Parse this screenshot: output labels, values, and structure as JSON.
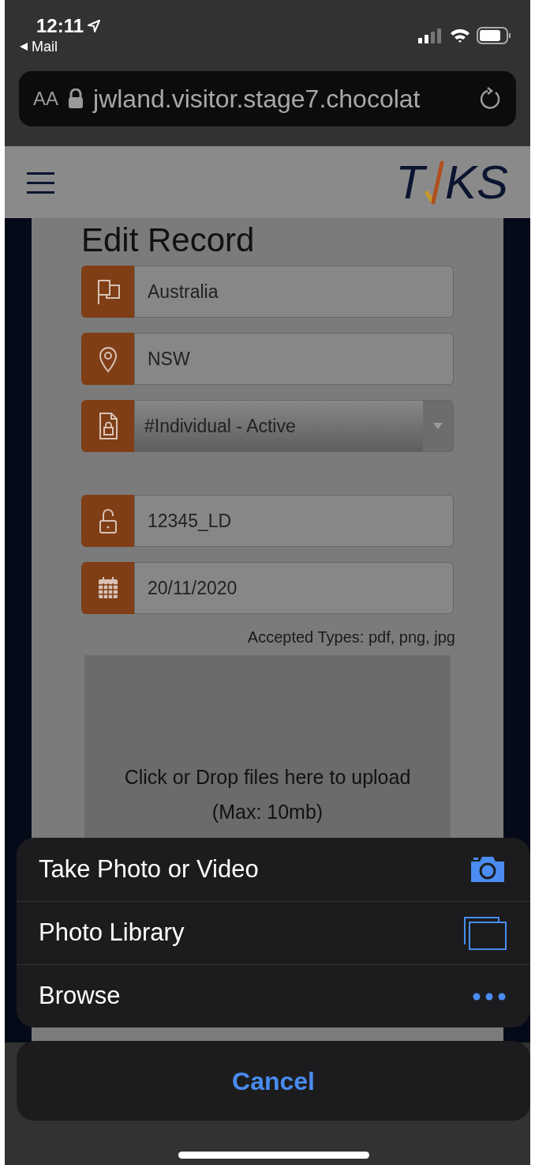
{
  "status_bar": {
    "time": "12:11",
    "back_label": "Mail"
  },
  "url_bar": {
    "text_size": "AA",
    "url": "jwland.visitor.stage7.chocolat"
  },
  "header": {
    "logo_left": "T",
    "logo_right": "KS"
  },
  "modal": {
    "title": "Edit Record",
    "fields": [
      {
        "kind": "text",
        "value": "Australia"
      },
      {
        "kind": "text",
        "value": "NSW"
      },
      {
        "kind": "select",
        "value": "#Individual - Active"
      },
      {
        "kind": "text",
        "value": "12345_LD"
      },
      {
        "kind": "text",
        "value": "20/11/2020"
      }
    ],
    "accepted_types": "Accepted Types: pdf, png, jpg",
    "dropzone": "Click or Drop files here to upload (Max: 10mb)"
  },
  "action_sheet": {
    "items": [
      {
        "label": "Take Photo or Video"
      },
      {
        "label": "Photo Library"
      },
      {
        "label": "Browse"
      }
    ],
    "cancel": "Cancel"
  }
}
